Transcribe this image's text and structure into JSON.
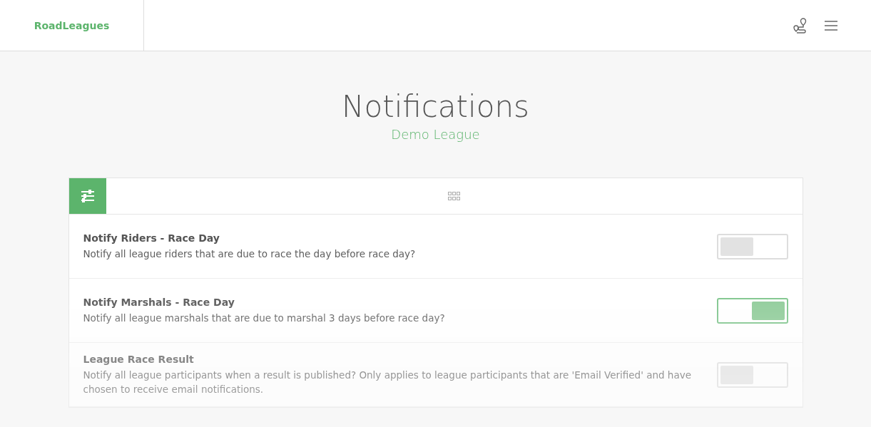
{
  "header": {
    "logo": "RoadLeagues"
  },
  "page": {
    "title": "Notifications",
    "subtitle": "Demo League"
  },
  "view_tabs": [
    {
      "kind": "filters",
      "selected": true
    },
    {
      "kind": "grid",
      "selected": false
    }
  ],
  "settings": [
    {
      "title": "Notify Riders - Race Day",
      "description": "Notify all league riders that are due to race the day before race day?",
      "on": false
    },
    {
      "title": "Notify Marshals - Race Day",
      "description": "Notify all league marshals that are due to marshal 3 days before race day?",
      "on": true
    },
    {
      "title": "League Race Result",
      "description": "Notify all league participants when a result is published? Only applies to league participants that are 'Email Verified' and have chosen to receive email notifications.",
      "on": false
    }
  ]
}
